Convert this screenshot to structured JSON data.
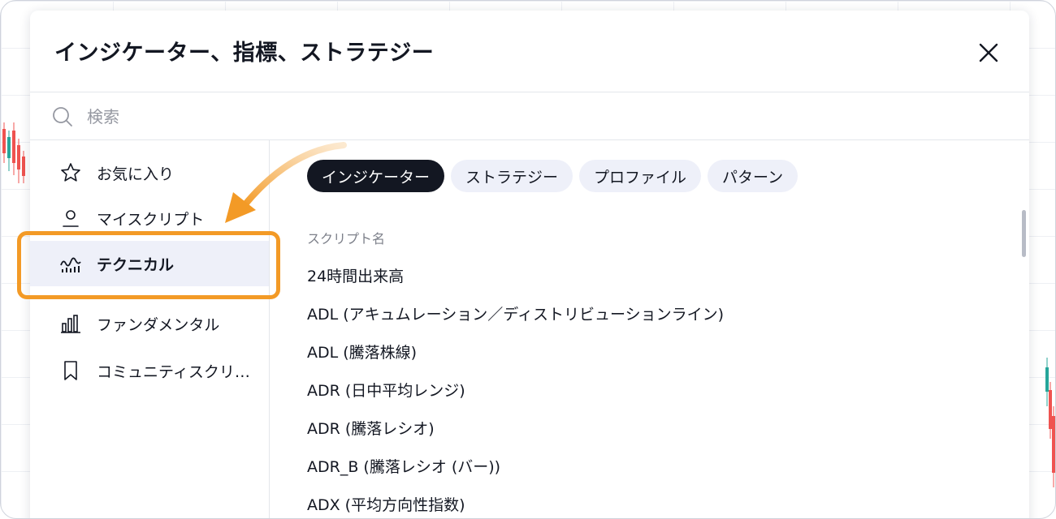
{
  "dialog": {
    "title": "インジケーター、指標、ストラテジー",
    "close_icon": "close-icon"
  },
  "search": {
    "placeholder": "検索",
    "value": "",
    "icon": "search-icon"
  },
  "sidebar": {
    "items": [
      {
        "label": "お気に入り",
        "icon": "star-icon",
        "active": false
      },
      {
        "label": "マイスクリプト",
        "icon": "user-icon",
        "active": false
      },
      {
        "label": "テクニカル",
        "icon": "chart-wave-icon",
        "active": true
      },
      {
        "label": "ファンダメンタル",
        "icon": "bar-chart-icon",
        "active": false
      },
      {
        "label": "コミュニティスクリ…",
        "icon": "bookmark-icon",
        "active": false
      }
    ]
  },
  "tabs": [
    {
      "label": "インジケーター",
      "active": true
    },
    {
      "label": "ストラテジー",
      "active": false
    },
    {
      "label": "プロファイル",
      "active": false
    },
    {
      "label": "パターン",
      "active": false
    }
  ],
  "list": {
    "column_header": "スクリプト名",
    "rows": [
      "24時間出来高",
      "ADL (アキュムレーション／ディストリビューションライン)",
      "ADL (騰落株線)",
      "ADR (日中平均レンジ)",
      "ADR (騰落レシオ)",
      "ADR_B (騰落レシオ (バー))",
      "ADX (平均方向性指数)"
    ]
  },
  "annotation": {
    "highlight_color": "#f39a26",
    "arrow_color": "#f39a26"
  },
  "colors": {
    "text": "#131722",
    "muted": "#7d808a",
    "active_tab_bg": "#131722",
    "tab_bg": "#eef0f9",
    "candle_up": "#26a69a",
    "candle_down": "#ef5350"
  }
}
